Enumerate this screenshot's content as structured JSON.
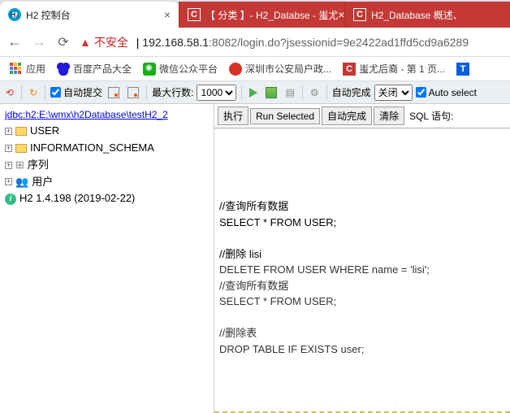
{
  "tabs": [
    {
      "title": "H2 控制台",
      "active": true,
      "favicon": "h2"
    },
    {
      "title": "【 分类 】- H2_Databse - 蚩尤",
      "active": false,
      "favicon": "c"
    },
    {
      "title": "H2_Database 概述、",
      "active": false,
      "favicon": "c"
    }
  ],
  "address": {
    "warning": "不安全",
    "host": "192.168.58.1",
    "port": ":8082",
    "path": "/login.do?jsessionid=9e2422ad1ffd5cd9a6289"
  },
  "bookmarks": [
    {
      "label": "应用",
      "icon": "grid"
    },
    {
      "label": "百度产品大全",
      "icon": "paw"
    },
    {
      "label": "微信公众平台",
      "icon": "wx"
    },
    {
      "label": "深圳市公安局户政...",
      "icon": "sz"
    },
    {
      "label": "蚩尤后裔 - 第 1 页...",
      "icon": "cc"
    },
    {
      "label": "",
      "icon": "t"
    }
  ],
  "toolbar": {
    "autocommit": "自动提交",
    "maxrows": "最大行数:",
    "maxrows_value": "1000",
    "autocomplete": "自动完成",
    "off": "关闭",
    "autoselect": "Auto select"
  },
  "tree": {
    "jdbc": "jdbc:h2:E:\\wmx\\h2Database\\testH2_2",
    "items": [
      "USER",
      "INFORMATION_SCHEMA",
      "序列",
      "用户"
    ],
    "version": "H2 1.4.198 (2019-02-22)"
  },
  "sqlbar": {
    "run": "执行",
    "runsel": "Run Selected",
    "autocomplete": "自动完成",
    "clear": "清除",
    "label": "SQL 语句:"
  },
  "editor": "//查询所有数据\nSELECT * FROM USER;\n\n//删除 lisi\nDELETE FROM USER WHERE name = 'lisi';\n//查询所有数据\nSELECT * FROM USER;\n\n//删除表\nDROP TABLE IF EXISTS user;"
}
